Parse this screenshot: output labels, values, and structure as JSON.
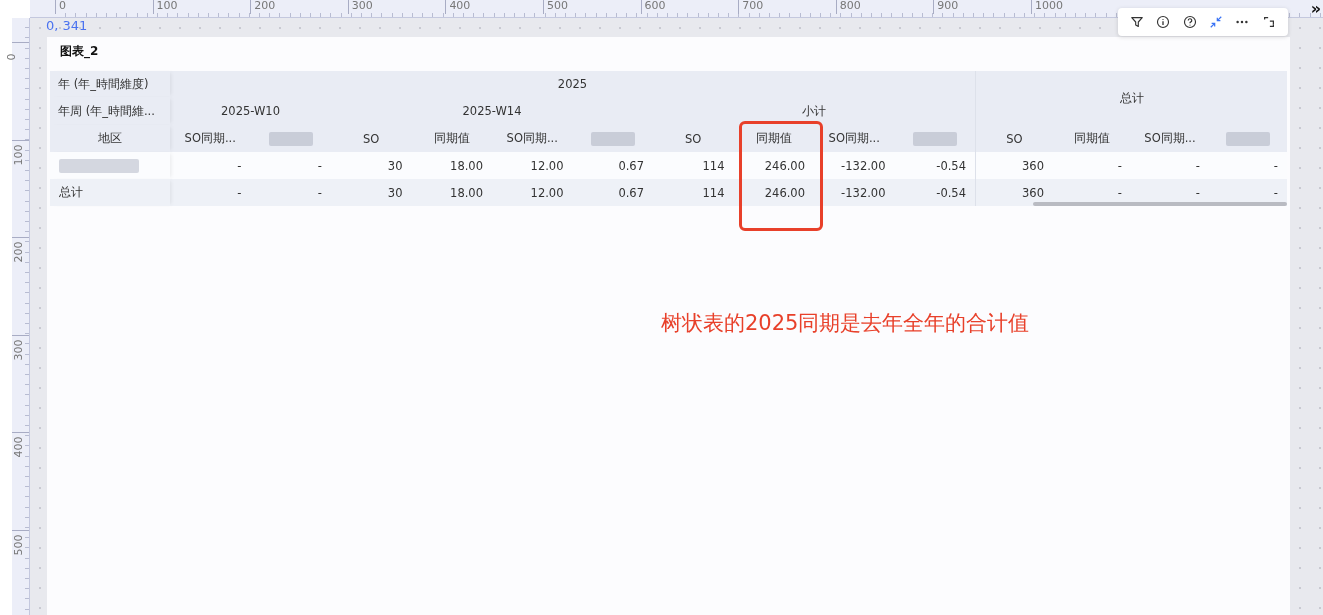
{
  "ruler": {
    "x_labels": [
      "0",
      "100",
      "200",
      "300",
      "400",
      "500",
      "600",
      "700",
      "800",
      "900",
      "1000"
    ],
    "y_labels": [
      "0",
      "100",
      "200",
      "300",
      "400",
      "500"
    ]
  },
  "position_label": "0, 341",
  "expand_glyph": "»",
  "chart": {
    "title": "图表_2",
    "table": {
      "corner_headers": [
        "年 (年_時間維度)",
        "年周 (年_時間維...",
        "地区"
      ],
      "year_header": "2025",
      "groups": [
        {
          "label": "2025-W10",
          "columns": [
            {
              "kind": "text",
              "label": "SO同期..."
            },
            {
              "kind": "blurred"
            }
          ]
        },
        {
          "label": "2025-W14",
          "columns": [
            {
              "kind": "text",
              "label": "SO"
            },
            {
              "kind": "text",
              "label": "同期值"
            },
            {
              "kind": "text",
              "label": "SO同期..."
            },
            {
              "kind": "blurred"
            }
          ]
        },
        {
          "label": "小计",
          "columns": [
            {
              "kind": "text",
              "label": "SO"
            },
            {
              "kind": "text",
              "label": "同期值"
            },
            {
              "kind": "text",
              "label": "SO同期..."
            },
            {
              "kind": "blurred"
            }
          ]
        }
      ],
      "total": {
        "label": "总计",
        "columns": [
          {
            "kind": "text",
            "label": "SO"
          },
          {
            "kind": "text",
            "label": "同期值"
          },
          {
            "kind": "text",
            "label": "SO同期..."
          },
          {
            "kind": "blurred"
          }
        ]
      },
      "rows": [
        {
          "kind": "blurred",
          "cells": [
            "-",
            "-",
            "30",
            "18.00",
            "12.00",
            "0.67",
            "114",
            "246.00",
            "-132.00",
            "-0.54",
            "360",
            "-",
            "-",
            "-"
          ]
        },
        {
          "kind": "text",
          "label": "总计",
          "cells": [
            "-",
            "-",
            "30",
            "18.00",
            "12.00",
            "0.67",
            "114",
            "246.00",
            "-132.00",
            "-0.54",
            "360",
            "-",
            "-",
            "-"
          ]
        }
      ]
    },
    "note": "树状表的2025同期是去年全年的合计值"
  }
}
